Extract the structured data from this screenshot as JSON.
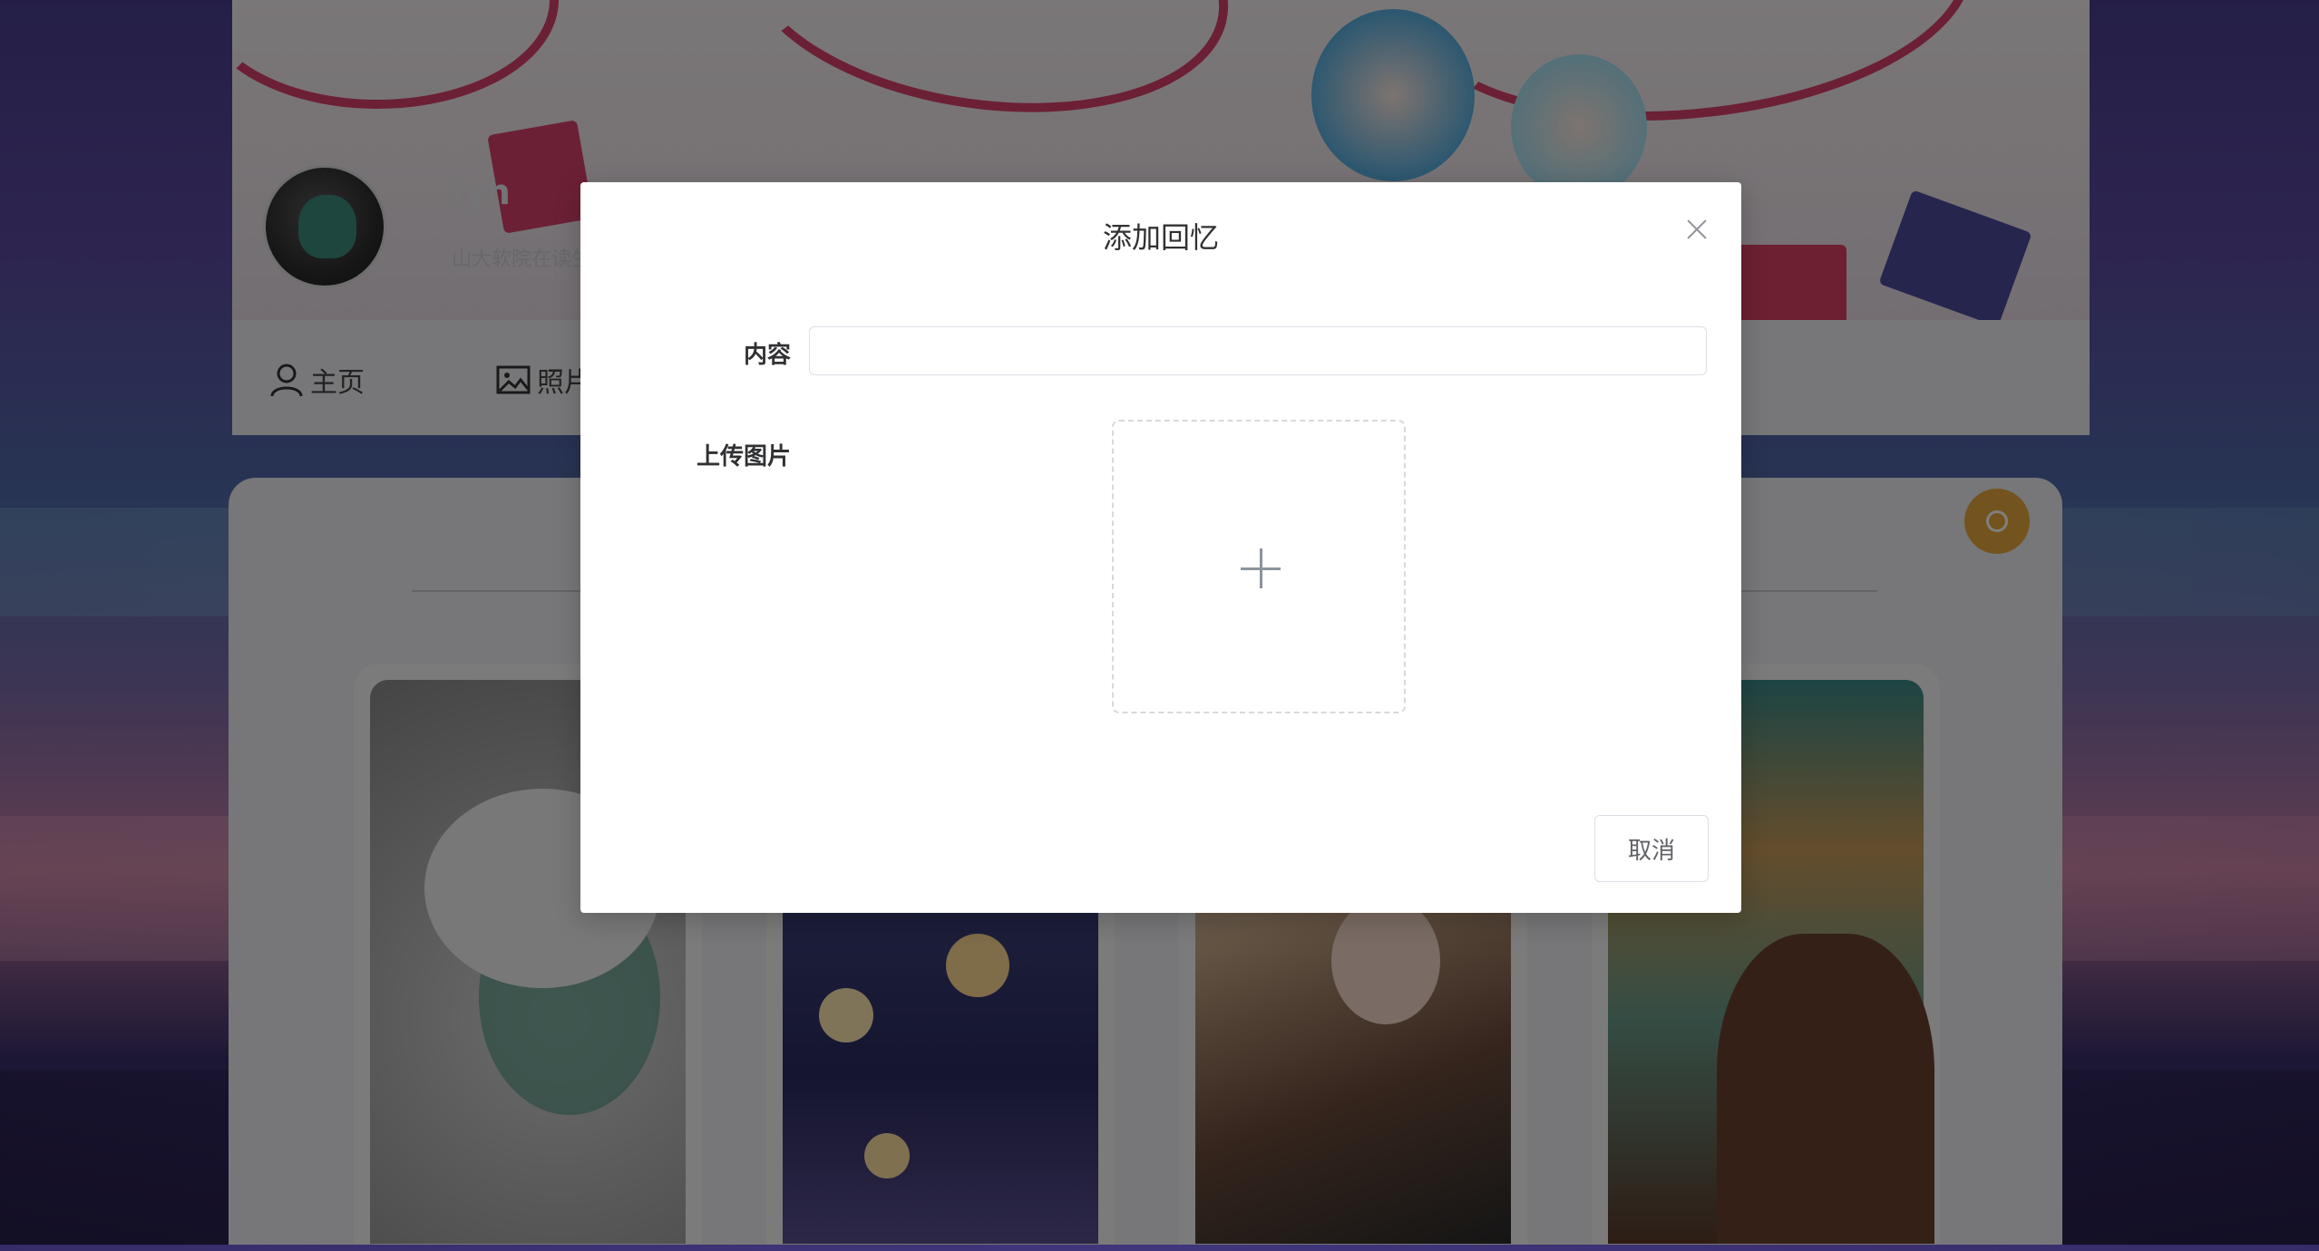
{
  "profile": {
    "username": "lyh",
    "signature": "山大软院在读生"
  },
  "nav": {
    "items": [
      {
        "label": "主页",
        "icon": "user-icon"
      },
      {
        "label": "照片",
        "icon": "picture-icon"
      }
    ]
  },
  "modal": {
    "title": "添加回忆",
    "content_label": "内容",
    "content_value": "",
    "upload_label": "上传图片",
    "cancel_label": "取消"
  },
  "colors": {
    "overlay": "rgba(0,0,0,0.5)",
    "fab": "#e6a93c",
    "ribbon": "#d8406a"
  }
}
